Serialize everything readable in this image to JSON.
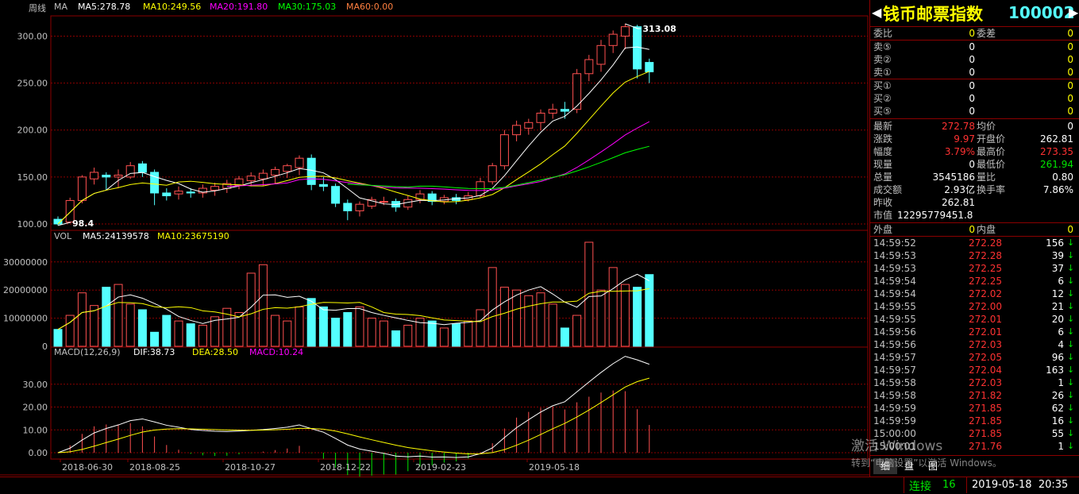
{
  "chart": {
    "period_label": "周线",
    "ma_title": "MA",
    "ma": [
      {
        "label": "MA5:278.78",
        "color": "#ffffff"
      },
      {
        "label": "MA10:249.56",
        "color": "#ffff00"
      },
      {
        "label": "MA20:191.80",
        "color": "#ff00ff"
      },
      {
        "label": "MA30:175.03",
        "color": "#00ff00"
      },
      {
        "label": "MA60:0.00",
        "color": "#ff8040"
      }
    ],
    "price_ticks": [
      "300.00",
      "250.00",
      "200.00",
      "150.00",
      "100.00"
    ],
    "high_label": "313.08",
    "low_label": "98.4",
    "vol_title": "VOL",
    "vol_ma": [
      {
        "label": "MA5:24139578",
        "color": "#ffffff"
      },
      {
        "label": "MA10:23675190",
        "color": "#ffff00"
      }
    ],
    "vol_ticks": [
      "30000000",
      "20000000",
      "10000000",
      "0"
    ],
    "macd_title": "MACD(12,26,9)",
    "macd_items": [
      {
        "label": "DIF:38.73",
        "color": "#ffffff"
      },
      {
        "label": "DEA:28.50",
        "color": "#ffff00"
      },
      {
        "label": "MACD:10.24",
        "color": "#ff00ff"
      }
    ],
    "macd_ticks": [
      "30.00",
      "20.00",
      "10.00",
      "0.00"
    ],
    "dates": [
      "2018-06-30",
      "2018-08-25",
      "2018-10-27",
      "2018-12-22",
      "2019-02-23",
      "2019-05-18"
    ]
  },
  "chart_data": {
    "type": "candlestick",
    "candles": [
      [
        105,
        100,
        108,
        98.4
      ],
      [
        102,
        125,
        128,
        101
      ],
      [
        125,
        150,
        152,
        122
      ],
      [
        148,
        155,
        160,
        142
      ],
      [
        152,
        150,
        155,
        136
      ],
      [
        150,
        152,
        158,
        138
      ],
      [
        150,
        162,
        166,
        148
      ],
      [
        164,
        155,
        167,
        150
      ],
      [
        155,
        133,
        158,
        120
      ],
      [
        133,
        130,
        138,
        125
      ],
      [
        132,
        135,
        140,
        126
      ],
      [
        134,
        133,
        138,
        128
      ],
      [
        133,
        138,
        142,
        128
      ],
      [
        136,
        140,
        144,
        130
      ],
      [
        138,
        143,
        147,
        133
      ],
      [
        141,
        148,
        151,
        137
      ],
      [
        146,
        151,
        155,
        140
      ],
      [
        148,
        154,
        158,
        141
      ],
      [
        152,
        158,
        161,
        143
      ],
      [
        156,
        162,
        164,
        149
      ],
      [
        160,
        170,
        173,
        152
      ],
      [
        170,
        142,
        174,
        136
      ],
      [
        142,
        140,
        150,
        135
      ],
      [
        140,
        122,
        143,
        118
      ],
      [
        122,
        114,
        126,
        104
      ],
      [
        114,
        121,
        124,
        108
      ],
      [
        119,
        126,
        129,
        116
      ],
      [
        124,
        124,
        129,
        120
      ],
      [
        124,
        118,
        127,
        113
      ],
      [
        118,
        126,
        130,
        115
      ],
      [
        126,
        132,
        136,
        122
      ],
      [
        132,
        124,
        135,
        120
      ],
      [
        124,
        128,
        131,
        121
      ],
      [
        128,
        125,
        132,
        121
      ],
      [
        126,
        130,
        134,
        124
      ],
      [
        130,
        145,
        149,
        128
      ],
      [
        145,
        162,
        165,
        142
      ],
      [
        162,
        195,
        200,
        158
      ],
      [
        195,
        205,
        210,
        188
      ],
      [
        202,
        208,
        212,
        195
      ],
      [
        208,
        218,
        222,
        200
      ],
      [
        218,
        222,
        228,
        212
      ],
      [
        222,
        220,
        230,
        212
      ],
      [
        222,
        260,
        265,
        218
      ],
      [
        260,
        275,
        280,
        252
      ],
      [
        270,
        290,
        296,
        262
      ],
      [
        290,
        302,
        306,
        282
      ],
      [
        300,
        310,
        313.08,
        286
      ],
      [
        310,
        265,
        312,
        255
      ],
      [
        272,
        262,
        276,
        250
      ]
    ],
    "volume": [
      6000000,
      11000000,
      19000000,
      14500000,
      21000000,
      22000000,
      15000000,
      13000000,
      5000000,
      11000000,
      9000000,
      8000000,
      7500000,
      10500000,
      13500000,
      12000000,
      26000000,
      29000000,
      11000000,
      9000000,
      14000000,
      17000000,
      14000000,
      10000000,
      12000000,
      14000000,
      10000000,
      9000000,
      5500000,
      7500000,
      10000000,
      9000000,
      6500000,
      8000000,
      9000000,
      13000000,
      28000000,
      21000000,
      20000000,
      18000000,
      19000000,
      15000000,
      6500000,
      11000000,
      37000000,
      20000000,
      28000000,
      22000000,
      21000000,
      25500000
    ],
    "macd": {
      "dif_last": 38.73,
      "dea_last": 28.5,
      "macd_last": 10.24
    },
    "price_ylim": [
      100,
      313.08
    ],
    "vol_ylim": [
      0,
      37000000
    ],
    "macd_ylim": [
      -5,
      40
    ]
  },
  "panel": {
    "title": "钱币邮票指数",
    "code": "100002",
    "weibi": {
      "l1": "委比",
      "v1": "0",
      "l2": "委差",
      "v2": "0"
    },
    "sell": [
      {
        "l": "卖⑤",
        "v": "0",
        "v2": "0"
      },
      {
        "l": "卖②",
        "v": "0",
        "v2": "0"
      },
      {
        "l": "卖①",
        "v": "0",
        "v2": "0"
      }
    ],
    "buy": [
      {
        "l": "买①",
        "v": "0",
        "v2": "0"
      },
      {
        "l": "买②",
        "v": "0",
        "v2": "0"
      },
      {
        "l": "买⑤",
        "v": "0",
        "v2": "0"
      }
    ],
    "quote": [
      {
        "l1": "最新",
        "v1": "272.78",
        "c1": "red",
        "l2": "均价",
        "v2": "0",
        "c2": "wht"
      },
      {
        "l1": "涨跌",
        "v1": "9.97",
        "c1": "red",
        "l2": "开盘价",
        "v2": "262.81",
        "c2": "wht"
      },
      {
        "l1": "幅度",
        "v1": "3.79%",
        "c1": "red",
        "l2": "最高价",
        "v2": "273.35",
        "c2": "red"
      },
      {
        "l1": "现量",
        "v1": "0",
        "c1": "wht",
        "l2": "最低价",
        "v2": "261.94",
        "c2": "grn"
      },
      {
        "l1": "总量",
        "v1": "3545186",
        "c1": "wht",
        "l2": "量比",
        "v2": "0.80",
        "c2": "wht"
      },
      {
        "l1": "成交额",
        "v1": "2.93亿",
        "c1": "wht",
        "l2": "换手率",
        "v2": "7.86%",
        "c2": "wht"
      }
    ],
    "zuoshou": {
      "l": "昨收",
      "v": "262.81"
    },
    "shizhi": {
      "l": "市值",
      "v": "12295779451.8"
    },
    "waipan": {
      "l": "外盘",
      "v": "0"
    },
    "neipan": {
      "l": "内盘",
      "v": "0"
    },
    "ticks": [
      {
        "t": "14:59:52",
        "p": "272.28",
        "v": "156"
      },
      {
        "t": "14:59:53",
        "p": "272.28",
        "v": "39"
      },
      {
        "t": "14:59:53",
        "p": "272.25",
        "v": "37"
      },
      {
        "t": "14:59:54",
        "p": "272.25",
        "v": "6"
      },
      {
        "t": "14:59:54",
        "p": "272.02",
        "v": "12"
      },
      {
        "t": "14:59:55",
        "p": "272.00",
        "v": "21"
      },
      {
        "t": "14:59:55",
        "p": "272.01",
        "v": "20"
      },
      {
        "t": "14:59:56",
        "p": "272.01",
        "v": "6"
      },
      {
        "t": "14:59:56",
        "p": "272.03",
        "v": "4"
      },
      {
        "t": "14:59:57",
        "p": "272.05",
        "v": "96"
      },
      {
        "t": "14:59:57",
        "p": "272.04",
        "v": "163"
      },
      {
        "t": "14:59:58",
        "p": "272.03",
        "v": "1"
      },
      {
        "t": "14:59:58",
        "p": "271.82",
        "v": "26"
      },
      {
        "t": "14:59:59",
        "p": "271.85",
        "v": "62"
      },
      {
        "t": "14:59:59",
        "p": "271.85",
        "v": "16"
      },
      {
        "t": "15:00:00",
        "p": "271.85",
        "v": "55"
      },
      {
        "t": "15:00:01",
        "p": "271.76",
        "v": "1"
      }
    ],
    "tabs": [
      "细",
      "盘",
      "图"
    ]
  },
  "status": {
    "conn_label": "连接",
    "conn_count": "16",
    "datetime": "2019-05-18  20:35"
  },
  "watermark": {
    "line1": "激活 Windows",
    "line2": "转到“电脑设置”以激活 Windows。"
  }
}
